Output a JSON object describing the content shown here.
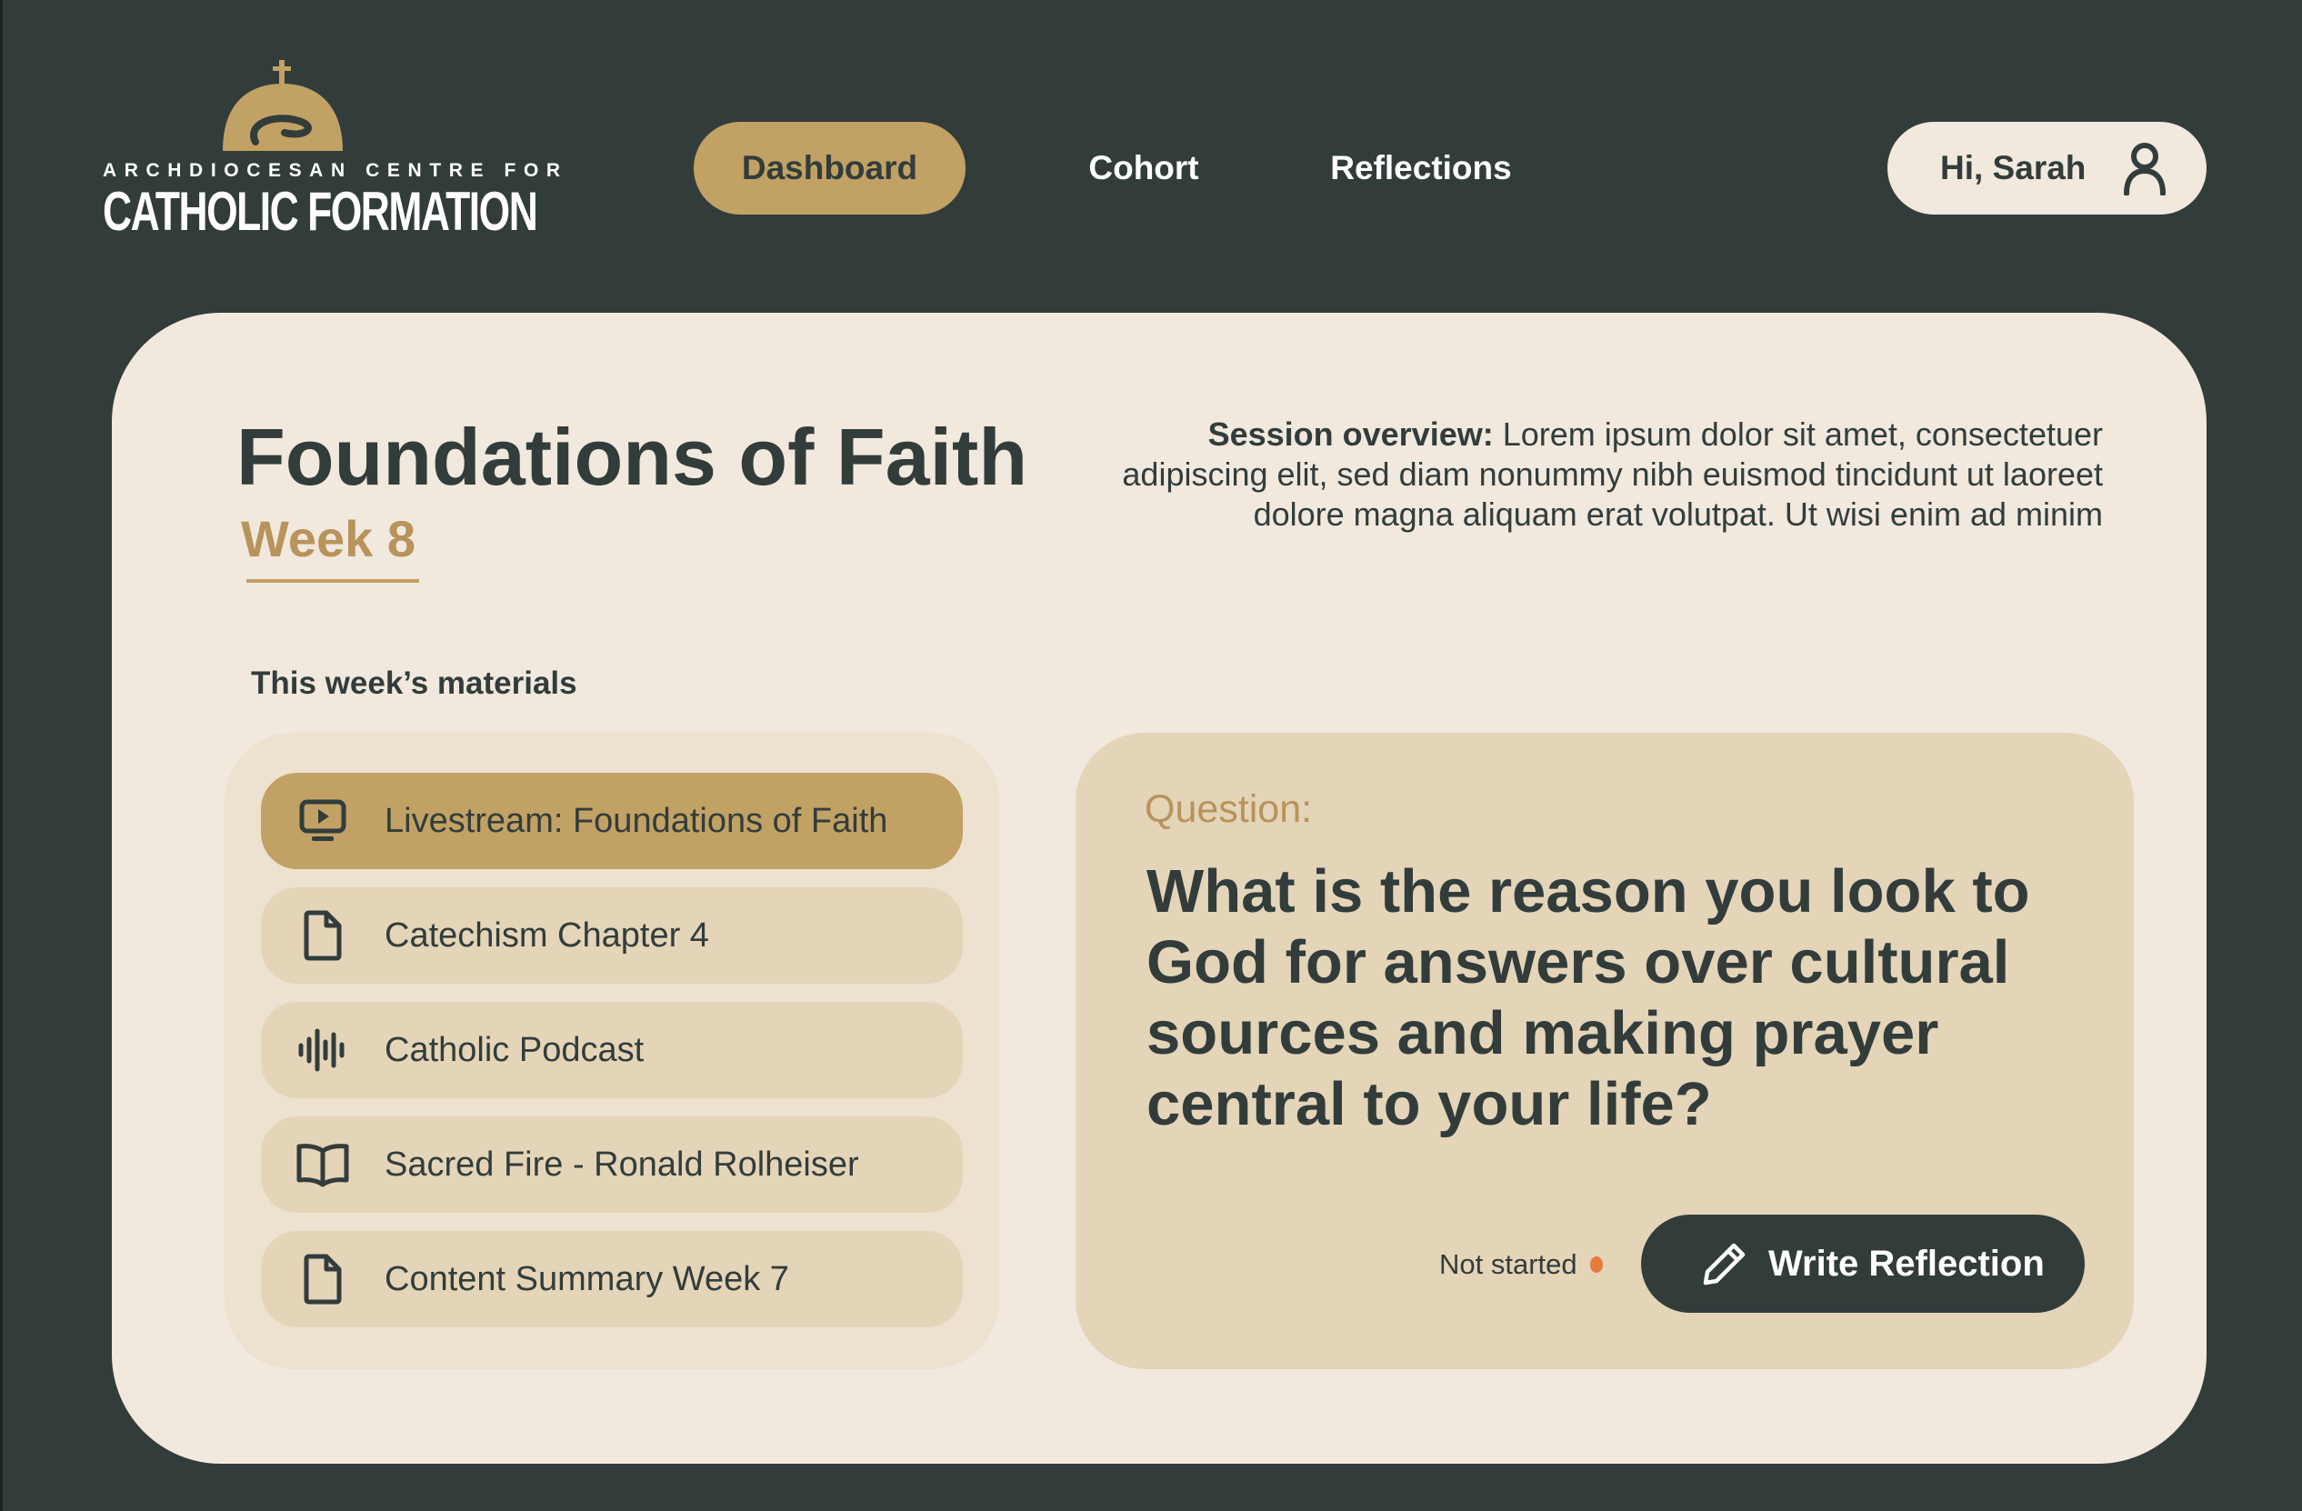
{
  "brand": {
    "line1": "ARCHDIOCESAN CENTRE FOR",
    "line2": "CATHOLIC FORMATION",
    "color": "#c2a164"
  },
  "nav": {
    "items": [
      {
        "label": "Dashboard",
        "active": true
      },
      {
        "label": "Cohort",
        "active": false
      },
      {
        "label": "Reflections",
        "active": false
      }
    ]
  },
  "user": {
    "greeting": "Hi, Sarah",
    "icon": "user-icon"
  },
  "course": {
    "title": "Foundations of Faith",
    "week": "Week 8",
    "overview_label": "Session overview:",
    "overview_text": " Lorem ipsum dolor sit amet, consectetuer adipiscing elit, sed diam nonummy nibh euismod tincidunt ut laoreet dolore magna aliquam erat volutpat. Ut wisi enim ad minim"
  },
  "materials": {
    "heading": "This week’s materials",
    "items": [
      {
        "label": "Livestream: Foundations of Faith",
        "icon": "livestream-icon",
        "active": true
      },
      {
        "label": "Catechism Chapter 4",
        "icon": "document-icon",
        "active": false
      },
      {
        "label": "Catholic Podcast",
        "icon": "audio-waveform-icon",
        "active": false
      },
      {
        "label": "Sacred Fire - Ronald Rolheiser",
        "icon": "book-icon",
        "active": false
      },
      {
        "label": "Content Summary Week 7",
        "icon": "document-icon",
        "active": false
      }
    ]
  },
  "question": {
    "label": "Question:",
    "text": "What is the reason you look to God for answers over cultural sources and making prayer central to your life?",
    "status": "Not started",
    "status_color": "#e57a3a",
    "action_label": "Write Reflection",
    "action_icon": "pencil-icon"
  },
  "colors": {
    "background": "#323d3b",
    "card": "#f1e8de",
    "accent": "#c2a164",
    "panel": "#e4d4b8"
  }
}
